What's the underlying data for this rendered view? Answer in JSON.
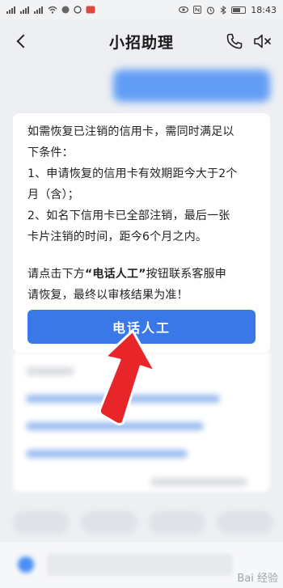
{
  "status_bar": {
    "time": "18:43"
  },
  "header": {
    "title": "小招助理"
  },
  "message": {
    "lines": [
      "如需恢复已注销的信用卡，需同时满足以",
      "下条件：",
      "1、申请恢复的信用卡有效期距今大于2个",
      "月（含）；",
      "2、如名下信用卡已全部注销，最后一张",
      "卡片注销的时间，距今6个月之内。"
    ],
    "cta_prefix": "请点击下方",
    "cta_highlight": "“电话人工”",
    "cta_suffix": "按钮联系客服申",
    "cta_line2": "请恢复，最终以审核结果为准！"
  },
  "call_button": {
    "label": "电话人工"
  },
  "watermark": {
    "text": "Bai 经验"
  },
  "colors": {
    "accent": "#3b78e7",
    "arrow": "#e8262a",
    "background": "#edeff3"
  }
}
